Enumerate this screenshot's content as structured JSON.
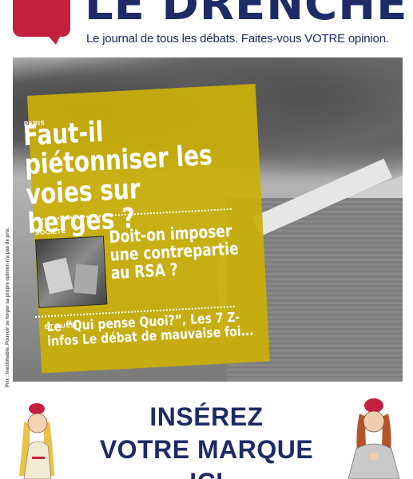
{
  "masthead": {
    "title": "LE DRENCHE",
    "tagline": "Le journal de tous les débats. Faites-vous VOTRE opinion."
  },
  "cover": {
    "section_1": "PARIS",
    "headline_1": "Faut-il piétonniser les voies sur berges ?",
    "section_2": "SOCIÉTÉ",
    "headline_2": "Doit-on imposer une contrepartie au RSA ?",
    "section_3": "ET AUSSI",
    "headline_3": "Le “Qui pense Quoi?”, Les 7 Z-infos Le débat de mauvaise foi...",
    "credit": "Prix : inestimable. Pouvoir se forger sa propre opinion n'a pas de prix."
  },
  "ad": {
    "line_1": "INSÉREZ",
    "line_2": "VOTRE MARQUE",
    "line_3": "ICI"
  },
  "colors": {
    "brand_red": "#c41f3e",
    "brand_navy": "#1d2b66",
    "overlay_yellow": "#cab008"
  }
}
